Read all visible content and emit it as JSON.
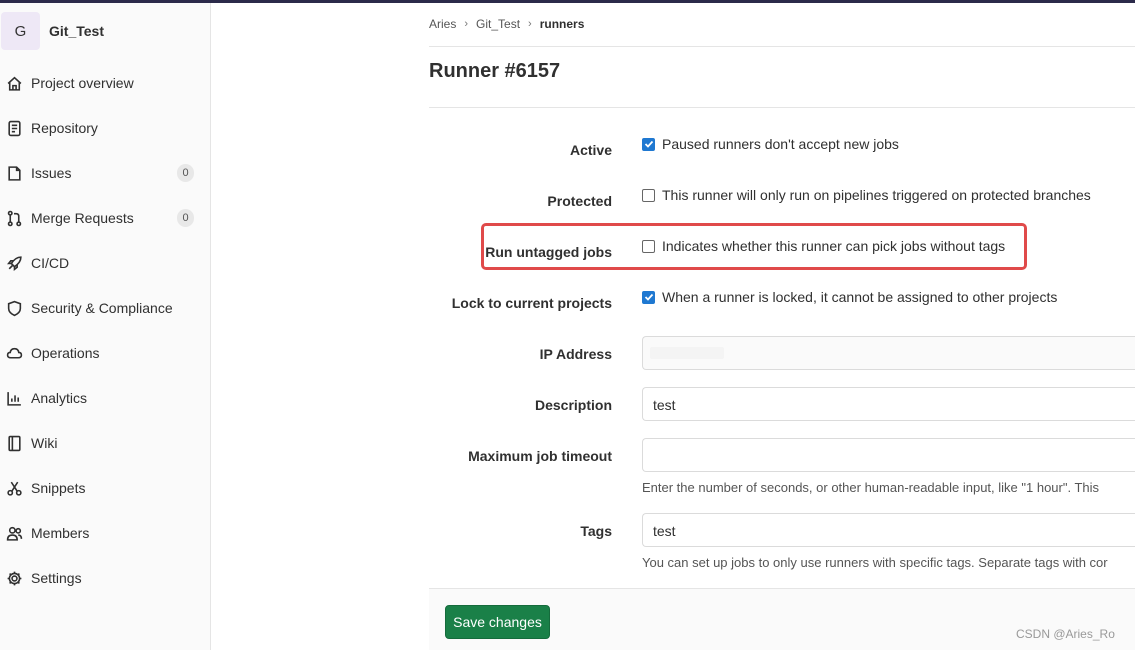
{
  "project": {
    "avatar_letter": "G",
    "name": "Git_Test"
  },
  "sidebar": {
    "items": [
      {
        "label": "Project overview",
        "icon": "home-icon"
      },
      {
        "label": "Repository",
        "icon": "doc-icon"
      },
      {
        "label": "Issues",
        "icon": "issues-icon",
        "badge": "0"
      },
      {
        "label": "Merge Requests",
        "icon": "merge-icon",
        "badge": "0"
      },
      {
        "label": "CI/CD",
        "icon": "rocket-icon"
      },
      {
        "label": "Security & Compliance",
        "icon": "shield-icon"
      },
      {
        "label": "Operations",
        "icon": "cloud-icon"
      },
      {
        "label": "Analytics",
        "icon": "chart-icon"
      },
      {
        "label": "Wiki",
        "icon": "book-icon"
      },
      {
        "label": "Snippets",
        "icon": "scissors-icon"
      },
      {
        "label": "Members",
        "icon": "users-icon"
      },
      {
        "label": "Settings",
        "icon": "gear-icon"
      }
    ]
  },
  "breadcrumb": {
    "items": [
      "Aries",
      "Git_Test"
    ],
    "current": "runners"
  },
  "page": {
    "title": "Runner #6157"
  },
  "form": {
    "active": {
      "label": "Active",
      "text": "Paused runners don't accept new jobs",
      "checked": true
    },
    "protected": {
      "label": "Protected",
      "text": "This runner will only run on pipelines triggered on protected branches",
      "checked": false
    },
    "untagged": {
      "label": "Run untagged jobs",
      "text": "Indicates whether this runner can pick jobs without tags",
      "checked": false
    },
    "locked": {
      "label": "Lock to current projects",
      "text": "When a runner is locked, it cannot be assigned to other projects",
      "checked": true
    },
    "ip": {
      "label": "IP Address",
      "value": ""
    },
    "description": {
      "label": "Description",
      "value": "test"
    },
    "timeout": {
      "label": "Maximum job timeout",
      "value": "",
      "help": "Enter the number of seconds, or other human-readable input, like \"1 hour\". This"
    },
    "tags": {
      "label": "Tags",
      "value": "test",
      "help": "You can set up jobs to only use runners with specific tags. Separate tags with cor"
    }
  },
  "actions": {
    "save_label": "Save changes"
  },
  "watermark": "CSDN @Aries_Ro",
  "colors": {
    "primary": "#1f78d1",
    "save": "#1a8048",
    "highlight": "#e04a4a"
  }
}
